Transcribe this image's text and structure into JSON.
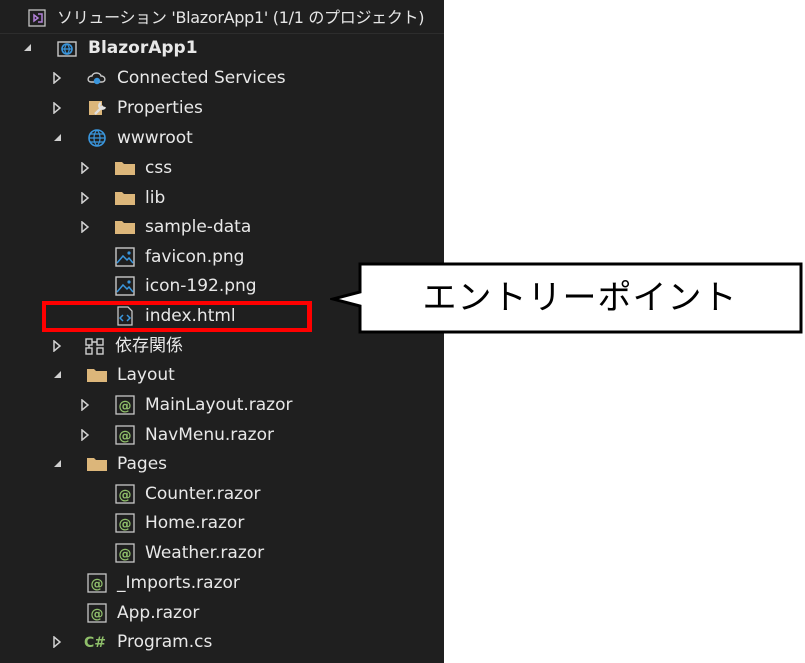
{
  "solution": {
    "title": "ソリューション 'BlazorApp1' (1/1 のプロジェクト)"
  },
  "tree": {
    "project": "BlazorApp1",
    "connected_services": "Connected Services",
    "properties": "Properties",
    "wwwroot": "wwwroot",
    "css": "css",
    "lib": "lib",
    "sample_data": "sample-data",
    "favicon": "favicon.png",
    "icon192": "icon-192.png",
    "index_html": "index.html",
    "dependencies": "依存関係",
    "layout": "Layout",
    "main_layout": "MainLayout.razor",
    "nav_menu": "NavMenu.razor",
    "pages": "Pages",
    "counter": "Counter.razor",
    "home": "Home.razor",
    "weather": "Weather.razor",
    "imports": "_Imports.razor",
    "app": "App.razor",
    "program": "Program.cs"
  },
  "callout": {
    "text": "エントリーポイント"
  },
  "colors": {
    "panel_bg": "#1f1f1f",
    "highlight": "#ff0000",
    "folder": "#dcb67a",
    "razor": "#8fbf6a",
    "globe": "#3a96dd"
  }
}
